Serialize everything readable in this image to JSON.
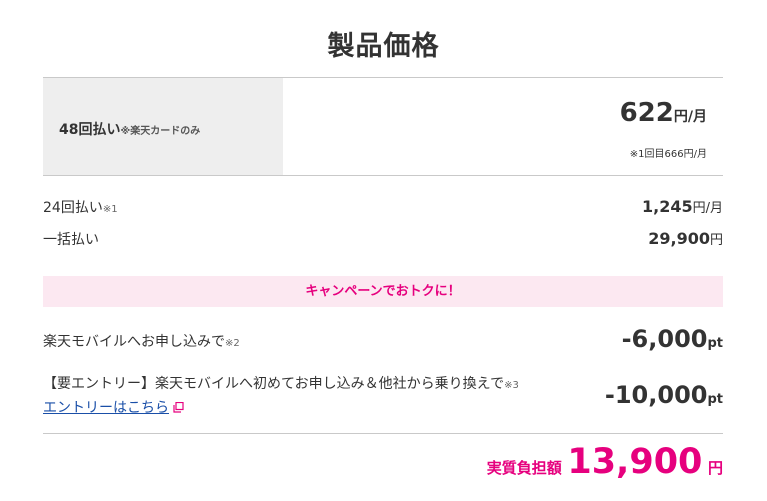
{
  "page_title": "製品価格",
  "installment_48": {
    "label": "48回払い",
    "label_note": "※楽天カードのみ",
    "price": "622",
    "unit": "円/月",
    "first_payment_note": "※1回目666円/月"
  },
  "installment_24": {
    "label": "24回払い",
    "label_note": "※1",
    "price": "1,245",
    "unit": "円/月"
  },
  "lump_sum": {
    "label": "一括払い",
    "price": "29,900",
    "unit": "円"
  },
  "campaign": {
    "banner": "キャンペーンでおトクに！",
    "items": [
      {
        "label": "楽天モバイルへお申し込みで",
        "note": "※2",
        "value": "-6,000",
        "unit": "pt"
      },
      {
        "label": "【要エントリー】楽天モバイルへ初めてお申し込み＆他社から乗り換えで",
        "note": "※3",
        "value": "-10,000",
        "unit": "pt",
        "link_label": "エントリーはこちら"
      }
    ]
  },
  "total": {
    "label": "実質負担額",
    "value": "13,900",
    "unit": "円"
  },
  "colors": {
    "accent": "#e6007e",
    "campaign_bg": "#fce8f1",
    "link": "#1a4fa8",
    "label_cell_bg": "#eeeeee"
  },
  "icons": {
    "external_link": "external-link-icon"
  }
}
